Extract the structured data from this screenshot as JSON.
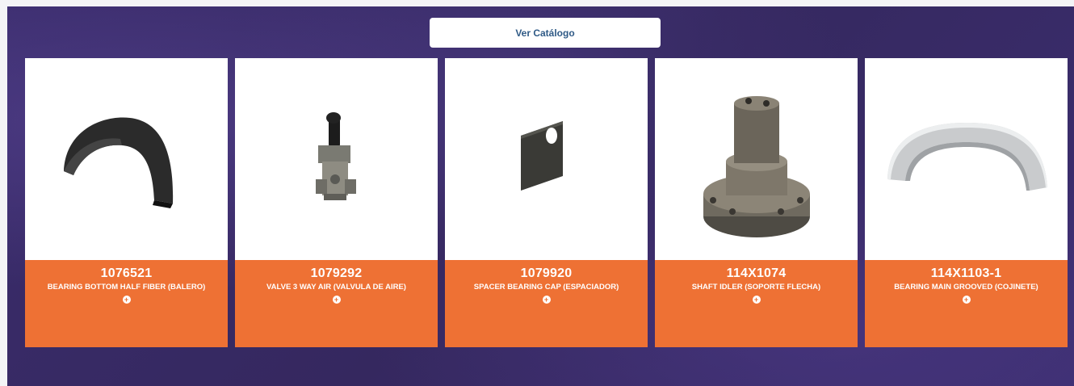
{
  "catalog_button": {
    "label": "Ver Catálogo"
  },
  "products": [
    {
      "code": "1076521",
      "description": "BEARING BOTTOM HALF FIBER (BALERO)",
      "image": "bearing-half-photo"
    },
    {
      "code": "1079292",
      "description": "VALVE 3 WAY AIR (VALVULA DE AIRE)",
      "image": "air-valve-photo"
    },
    {
      "code": "1079920",
      "description": "SPACER BEARING CAP (ESPACIADOR)",
      "image": "spacer-plate-photo"
    },
    {
      "code": "114X1074",
      "description": "SHAFT IDLER (SOPORTE FLECHA)",
      "image": "shaft-idler-photo"
    },
    {
      "code": "114X1103-1",
      "description": "BEARING MAIN GROOVED (COJINETE)",
      "image": "bearing-grooved-photo"
    }
  ],
  "more_icon": "plus-circle-icon",
  "colors": {
    "accent": "#ee7134",
    "background": "#3a2c6c",
    "button_text": "#2f5a86"
  }
}
